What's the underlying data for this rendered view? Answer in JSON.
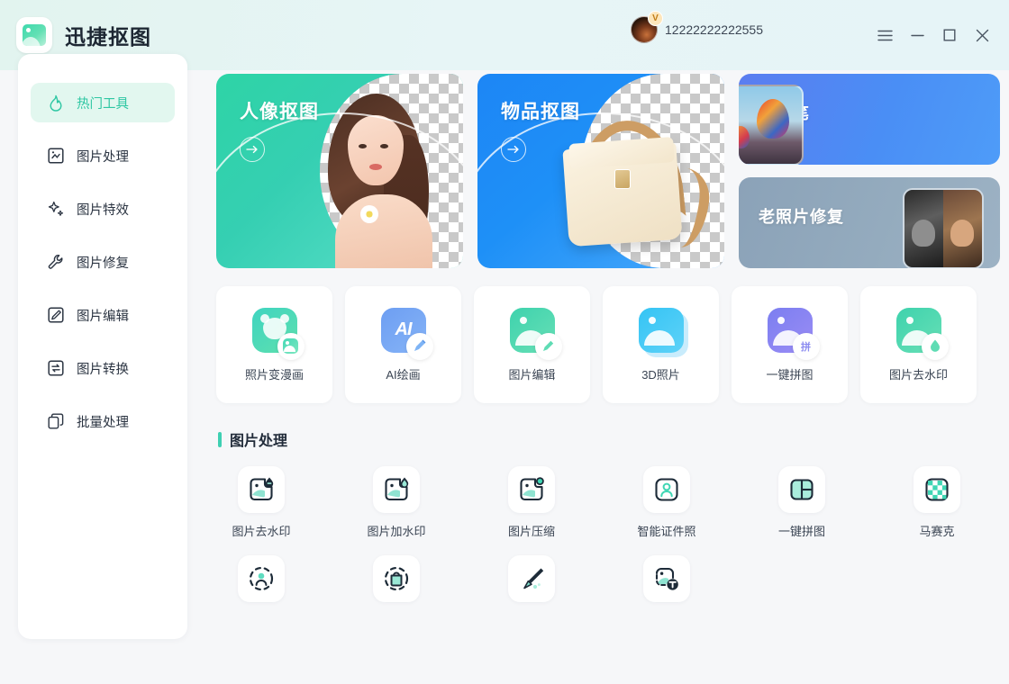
{
  "app": {
    "title": "迅捷抠图",
    "logo_icon": "image-logo-icon"
  },
  "account": {
    "name": "12222222222555",
    "vip_badge": "V",
    "avatar_icon": "user-avatar"
  },
  "window_controls": {
    "menu": "menu-icon",
    "minimize": "minimize-icon",
    "maximize": "maximize-icon",
    "close": "close-icon"
  },
  "sidebar": {
    "items": [
      {
        "label": "热门工具",
        "icon": "flame-icon",
        "active": true
      },
      {
        "label": "图片处理",
        "icon": "image-process-icon",
        "active": false
      },
      {
        "label": "图片特效",
        "icon": "sparkle-icon",
        "active": false
      },
      {
        "label": "图片修复",
        "icon": "wrench-icon",
        "active": false
      },
      {
        "label": "图片编辑",
        "icon": "pencil-square-icon",
        "active": false
      },
      {
        "label": "图片转换",
        "icon": "convert-icon",
        "active": false
      },
      {
        "label": "批量处理",
        "icon": "copy-icon",
        "active": false
      }
    ]
  },
  "hero": {
    "portrait": {
      "title": "人像抠图",
      "arrow_icon": "arrow-right-icon"
    },
    "object": {
      "title": "物品抠图",
      "arrow_icon": "arrow-right-icon"
    },
    "eraser": {
      "title": "消除笔"
    },
    "restore": {
      "title": "老照片修复"
    }
  },
  "quick_tools": [
    {
      "label": "照片变漫画",
      "icon": "cartoon-icon"
    },
    {
      "label": "AI绘画",
      "icon": "ai-paint-icon"
    },
    {
      "label": "图片编辑",
      "icon": "image-edit-icon"
    },
    {
      "label": "3D照片",
      "icon": "3d-photo-icon"
    },
    {
      "label": "一键拼图",
      "icon": "collage-icon"
    },
    {
      "label": "图片去水印",
      "icon": "remove-watermark-icon"
    }
  ],
  "section": {
    "title": "图片处理",
    "accent_color": "#3ed0b2"
  },
  "tools_row1": [
    {
      "label": "图片去水印",
      "icon": "remove-watermark-icon"
    },
    {
      "label": "图片加水印",
      "icon": "add-watermark-icon"
    },
    {
      "label": "图片压缩",
      "icon": "compress-icon"
    },
    {
      "label": "智能证件照",
      "icon": "id-photo-icon"
    },
    {
      "label": "一键拼图",
      "icon": "collage-icon"
    },
    {
      "label": "马赛克",
      "icon": "mosaic-icon"
    }
  ],
  "tools_row2": [
    {
      "label": "",
      "icon": "portrait-cutout-icon"
    },
    {
      "label": "",
      "icon": "object-cutout-icon"
    },
    {
      "label": "",
      "icon": "eraser-brush-icon"
    },
    {
      "label": "",
      "icon": "image-text-icon"
    }
  ],
  "theme": {
    "header_gradient_start": "#e2f4ef",
    "header_gradient_end": "#e6f4f7",
    "background": "#f6f7f9",
    "accent_teal": "#2fc7a3",
    "accent_blue": "#1d86f5"
  }
}
